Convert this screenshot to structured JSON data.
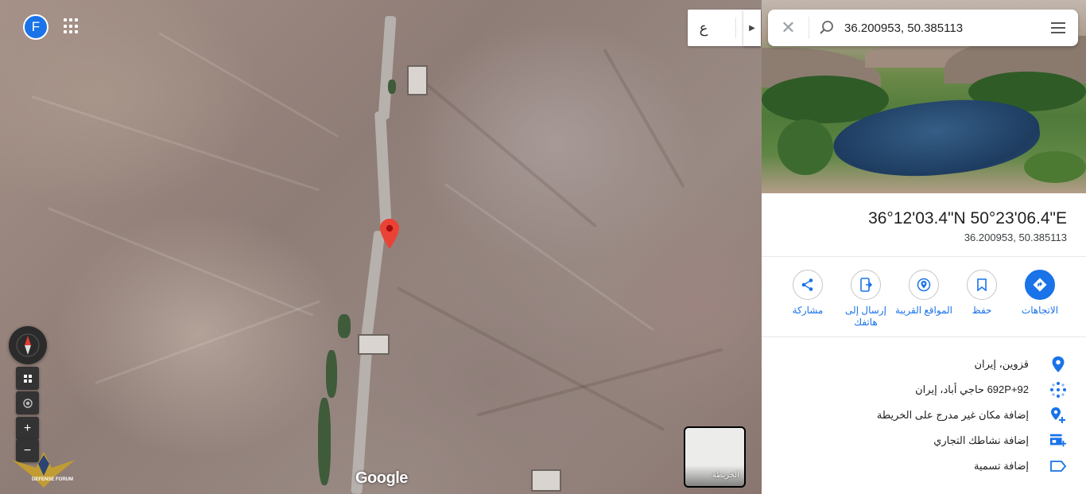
{
  "map": {
    "avatar_letter": "F",
    "language_label": "ع",
    "google_logo": "Google",
    "thumbnail_label": "الخريطة",
    "zoom_in": "+",
    "zoom_out": "−",
    "watermark_text": "DEFENSE FORUM"
  },
  "search": {
    "query": "36.200953, 50.385113"
  },
  "place": {
    "title_dms": "36°12'03.4\"N 50°23'06.4\"E",
    "title_decimal": "36.200953, 50.385113"
  },
  "actions": [
    {
      "label": "الاتجاهات",
      "icon": "directions-icon"
    },
    {
      "label": "حفظ",
      "icon": "bookmark-icon"
    },
    {
      "label": "المواقع القريبة",
      "icon": "nearby-icon"
    },
    {
      "label": "إرسال إلى هاتفك",
      "icon": "send-to-phone-icon"
    },
    {
      "label": "مشاركة",
      "icon": "share-icon"
    }
  ],
  "info": [
    {
      "text": "قزوين، إيران",
      "icon": "location-pin-icon"
    },
    {
      "text": "692P+92 حاجي أباد، إيران",
      "icon": "plus-code-icon"
    },
    {
      "text": "إضافة مكان غير مدرج على الخريطة",
      "icon": "add-place-icon"
    },
    {
      "text": "إضافة نشاطك التجاري",
      "icon": "add-business-icon"
    },
    {
      "text": "إضافة تسمية",
      "icon": "label-icon"
    }
  ],
  "colors": {
    "accent": "#1a73e8",
    "pin": "#ea4335"
  }
}
